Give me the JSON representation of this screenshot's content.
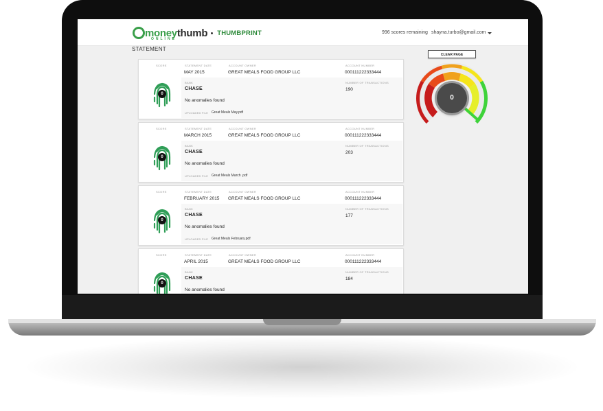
{
  "app": {
    "logo_word_1": "money",
    "logo_word_2": "thumb",
    "logo_sub": "ONLINE",
    "product": "THUMBPRINT",
    "scores_remaining": "996 scores remaining",
    "user_email": "shayna.turbo@gmail.com"
  },
  "page": {
    "title": "STATEMENT",
    "clear_button": "CLEAR PAGE"
  },
  "labels": {
    "score": "SCORE",
    "statement_date": "STATEMENT DATE",
    "account_owner": "ACCOUNT OWNER",
    "account_number": "ACCOUNT NUMBER",
    "bank": "BANK",
    "num_transactions": "NUMBER OF TRANSACTIONS",
    "uploaded_file": "UPLOADED FILE"
  },
  "gauge": {
    "value": "0",
    "colors": [
      "#c61c1c",
      "#e84a1a",
      "#f0a11c",
      "#f5e51a",
      "#3ed33a"
    ]
  },
  "statements": [
    {
      "score": "0",
      "statement_date": "MAY 2015",
      "account_owner": "GREAT MEALS FOOD GROUP LLC",
      "account_number": "000111222333444",
      "bank": "CHASE",
      "transactions": "190",
      "anomalies": "No anomalies found",
      "file": "Great Meals May.pdf"
    },
    {
      "score": "0",
      "statement_date": "MARCH 2015",
      "account_owner": "GREAT MEALS FOOD GROUP LLC",
      "account_number": "000111222333444",
      "bank": "CHASE",
      "transactions": "203",
      "anomalies": "No anomalies found",
      "file": "Great Meals March .pdf"
    },
    {
      "score": "0",
      "statement_date": "FEBRUARY 2015",
      "account_owner": "GREAT MEALS FOOD GROUP LLC",
      "account_number": "000111222333444",
      "bank": "CHASE",
      "transactions": "177",
      "anomalies": "No anomalies found",
      "file": "Great Meals February.pdf"
    },
    {
      "score": "0",
      "statement_date": "APRIL 2015",
      "account_owner": "GREAT MEALS FOOD GROUP LLC",
      "account_number": "000111222333444",
      "bank": "CHASE",
      "transactions": "184",
      "anomalies": "No anomalies found",
      "file": ""
    }
  ]
}
